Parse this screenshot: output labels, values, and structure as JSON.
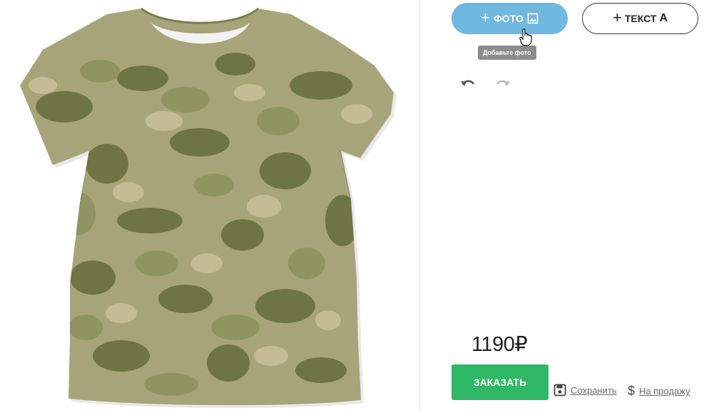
{
  "toolbar": {
    "photo_label": "ФОТО",
    "text_label": "ТЕКСТ",
    "text_icon_glyph": "A",
    "photo_tooltip": "Добавьте фото",
    "undo_icon": "undo-icon",
    "redo_icon": "redo-icon"
  },
  "product": {
    "price": "1190₽",
    "order_label": "ЗАКАЗАТЬ",
    "save_label": "Сохранить",
    "sell_label": "На продажу",
    "sell_icon_glyph": "$"
  },
  "colors": {
    "photo_button": "#6fb8e0",
    "order_button": "#2fb865",
    "camo_base": "#a8a47a",
    "camo_dark": "#6f7444",
    "camo_mid": "#8f9462",
    "camo_light": "#c4bc94"
  }
}
